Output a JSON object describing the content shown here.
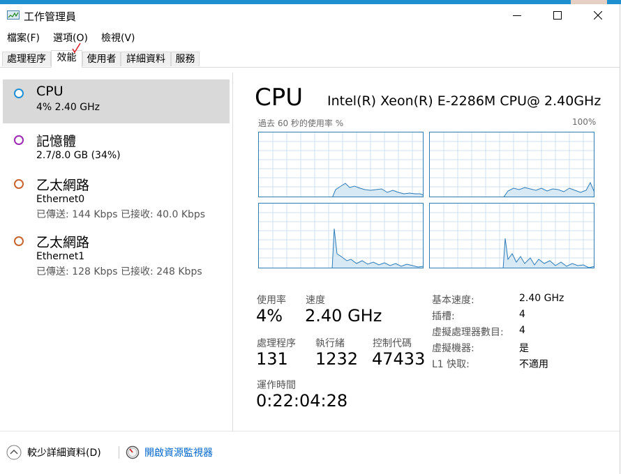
{
  "window": {
    "title": "工作管理員",
    "minimize_icon": "minimize-icon",
    "maximize_icon": "maximize-icon",
    "close_icon": "close-icon"
  },
  "menu": [
    "檔案(F)",
    "選項(O)",
    "檢視(V)"
  ],
  "tabs": [
    "處理程序",
    "效能",
    "使用者",
    "詳細資料",
    "服務"
  ],
  "sidebar": {
    "items": [
      {
        "name": "CPU",
        "sub": "4% 2.40 GHz",
        "color": "#1c8fd6"
      },
      {
        "name": "記憶體",
        "sub": "2.7/8.0 GB (34%)",
        "color": "#9e28b4"
      },
      {
        "name": "乙太網路",
        "sub": "Ethernet0",
        "sub2": "已傳送: 144 Kbps 已接收: 40.0 Kbps",
        "color": "#c8642d"
      },
      {
        "name": "乙太網路",
        "sub": "Ethernet1",
        "sub2": "已傳送: 128 Kbps 已接收: 248 Kbps",
        "color": "#c8642d"
      }
    ]
  },
  "main": {
    "title": "CPU",
    "model": "Intel(R) Xeon(R) E-2286M CPU@ 2.40GHz",
    "graph_label": "過去 60 秒的使用率 %",
    "graph_max": "100%",
    "accent": "#2b7bb7"
  },
  "stats": {
    "usage": {
      "label": "使用率",
      "value": "4%"
    },
    "speed": {
      "label": "速度",
      "value": "2.40 GHz"
    },
    "processes": {
      "label": "處理程序",
      "value": "131"
    },
    "threads": {
      "label": "執行緒",
      "value": "1232"
    },
    "handles": {
      "label": "控制代碼",
      "value": "47433"
    },
    "uptime": {
      "label": "運作時間",
      "value": "0:22:04:28"
    }
  },
  "info": [
    {
      "label": "基本速度:",
      "value": "2.40 GHz"
    },
    {
      "label": "插槽:",
      "value": "4"
    },
    {
      "label": "虛擬處理器數目:",
      "value": "4"
    },
    {
      "label": "虛擬機器:",
      "value": "是"
    },
    {
      "label": "L1 快取:",
      "value": "不適用"
    }
  ],
  "footer": {
    "fewer_details": "較少詳細資料(D)",
    "resource_monitor": "開啟資源監視器"
  }
}
